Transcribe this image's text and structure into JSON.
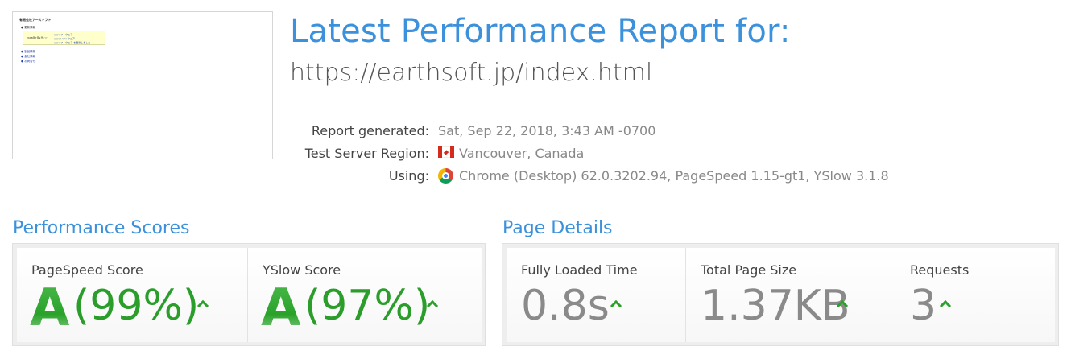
{
  "thumbnail": {
    "site_title": "有限会社アースソフト",
    "bullet": "● 更新情報",
    "box_left": "2018年7月9日 ○○",
    "box_lines": [
      "○○ソフトウェア",
      "○○○ソフトウェア",
      "○○ソフトウェア を更新しました"
    ],
    "links": [
      "● 製品情報",
      "● 会社情報",
      "● お問合せ"
    ]
  },
  "header": {
    "title": "Latest Performance Report for:",
    "url": "https://earthsoft.jp/index.html"
  },
  "meta": {
    "report_label": "Report generated:",
    "report_value": "Sat, Sep 22, 2018, 3:43 AM -0700",
    "region_label": "Test Server Region:",
    "region_value": "Vancouver, Canada",
    "region_icon": "canada-flag-icon",
    "using_label": "Using:",
    "using_value": "Chrome (Desktop) 62.0.3202.94, PageSpeed 1.15-gt1, YSlow 3.1.8",
    "using_icon": "chrome-icon"
  },
  "performance": {
    "title": "Performance Scores",
    "pagespeed": {
      "label": "PageSpeed Score",
      "grade": "A",
      "percent": "(99%)"
    },
    "yslow": {
      "label": "YSlow Score",
      "grade": "A",
      "percent": "(97%)"
    }
  },
  "details": {
    "title": "Page Details",
    "loaded": {
      "label": "Fully Loaded Time",
      "value": "0.8s"
    },
    "size": {
      "label": "Total Page Size",
      "value": "1.37KB"
    },
    "requests": {
      "label": "Requests",
      "value": "3"
    }
  },
  "colors": {
    "accent": "#3b91dc",
    "grade_green": "#2a9d2a",
    "muted": "#8a8a8a"
  }
}
